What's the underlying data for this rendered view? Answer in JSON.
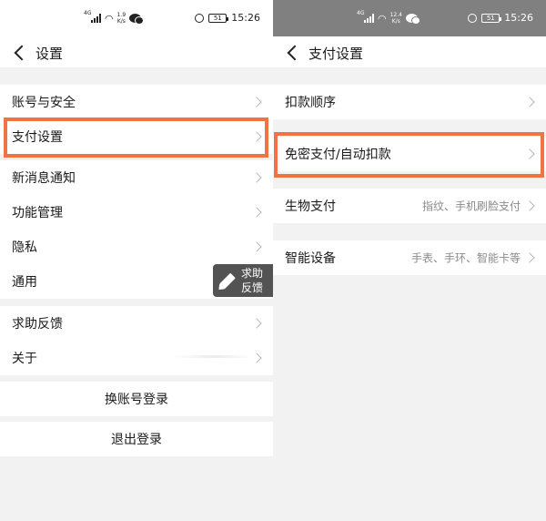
{
  "left": {
    "status": {
      "signal": "4G",
      "speed_top": "1.9",
      "speed_unit": "K/s",
      "battery": "51",
      "time": "15:26"
    },
    "title": "设置",
    "group1": [
      {
        "label": "账号与安全"
      },
      {
        "label": "支付设置"
      },
      {
        "label": "新消息通知"
      },
      {
        "label": "功能管理"
      },
      {
        "label": "隐私"
      },
      {
        "label": "通用"
      }
    ],
    "group2": [
      {
        "label": "求助反馈"
      },
      {
        "label": "关于"
      }
    ],
    "switch_account": "换账号登录",
    "logout": "退出登录",
    "help_fab": {
      "line1": "求助",
      "line2": "反馈"
    }
  },
  "right": {
    "status": {
      "signal": "4G",
      "speed_top": "12.4",
      "speed_unit": "K/s",
      "battery": "51",
      "time": "15:26"
    },
    "title": "支付设置",
    "items": [
      {
        "label": "扣款顺序",
        "value": ""
      },
      {
        "label": "免密支付/自动扣款",
        "value": ""
      },
      {
        "label": "生物支付",
        "value": "指纹、手机刷脸支付"
      },
      {
        "label": "智能设备",
        "value": "手表、手环、智能卡等"
      }
    ]
  },
  "colors": {
    "highlight": "#ef7343",
    "background": "#f2f2f2",
    "fab": "#535353"
  }
}
